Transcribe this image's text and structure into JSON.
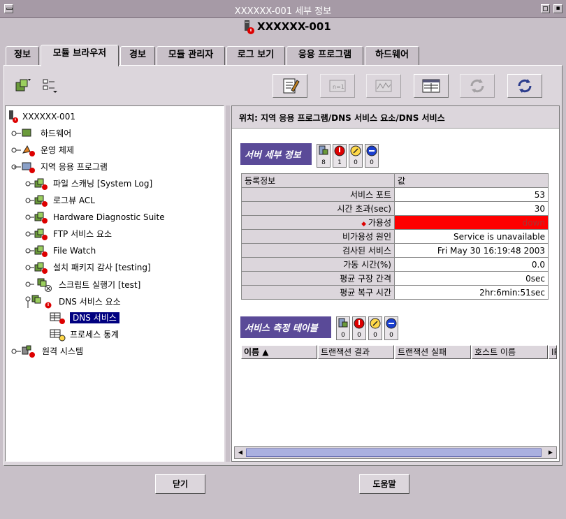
{
  "window": {
    "title": "XXXXXX-001 세부 정보",
    "header": "XXXXXX-001"
  },
  "tabs": [
    {
      "label": "정보"
    },
    {
      "label": "모듈 브라우저"
    },
    {
      "label": "경보"
    },
    {
      "label": "모듈 관리자"
    },
    {
      "label": "로그 보기"
    },
    {
      "label": "응용 프로그램"
    },
    {
      "label": "하드웨어"
    }
  ],
  "location": "위치: 지역 응용 프로그램/DNS 서비스 요소/DNS 서비스",
  "tree": {
    "root": "XXXXXX-001",
    "items": [
      {
        "label": "하드웨어"
      },
      {
        "label": "운영 체제"
      },
      {
        "label": "지역 응용 프로그램"
      },
      {
        "label": "파일 스캐닝 [System Log]"
      },
      {
        "label": "로그뷰 ACL"
      },
      {
        "label": "Hardware Diagnostic Suite"
      },
      {
        "label": "FTP 서비스 요소"
      },
      {
        "label": "File Watch"
      },
      {
        "label": "설치 패키지 감사 [testing]"
      },
      {
        "label": "스크립트 실행기 [test]"
      },
      {
        "label": "DNS 서비스 요소"
      },
      {
        "label": "DNS 서비스"
      },
      {
        "label": "프로세스 통계"
      },
      {
        "label": "원격 시스템"
      }
    ]
  },
  "details": {
    "title": "서버 세부 정보",
    "counts": [
      "8",
      "1",
      "0",
      "0"
    ],
    "header_key": "등록정보",
    "header_value": "값",
    "rows": [
      {
        "key": "서비스 포트",
        "value": "53"
      },
      {
        "key": "시간 초과(sec)",
        "value": "30"
      },
      {
        "key": "가용성",
        "value": "down"
      },
      {
        "key": "비가용성 원인",
        "value": "Service is unavailable"
      },
      {
        "key": "검사된 서비스",
        "value": "Fri May 30 16:19:48 2003"
      },
      {
        "key": "가동 시간(%)",
        "value": "0.0"
      },
      {
        "key": "평균 구장 간격",
        "value": "0sec"
      },
      {
        "key": "평균 복구 시간",
        "value": "2hr:6min:51sec"
      }
    ]
  },
  "measure": {
    "title": "서비스 측정 테이블",
    "counts": [
      "0",
      "0",
      "0",
      "0"
    ],
    "columns": [
      "이름 ▲",
      "트랜잭션 결과",
      "트랜잭션 실패",
      "호스트 이름",
      "IP"
    ]
  },
  "buttons": {
    "close": "닫기",
    "help": "도움말"
  },
  "colors": {
    "selection": "#000080",
    "title_panel": "#5a4a98",
    "alert_down": "#ff0000"
  }
}
